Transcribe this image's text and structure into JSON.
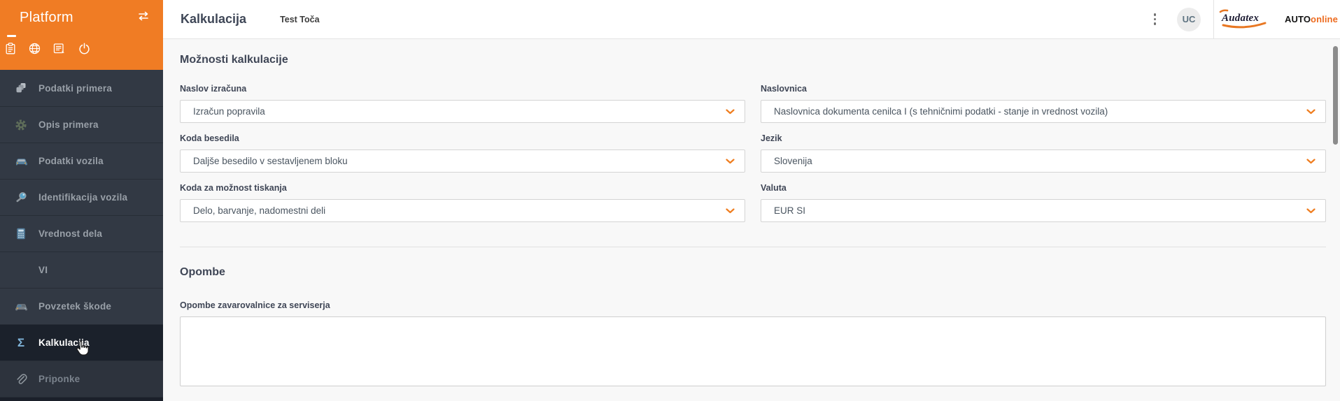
{
  "app": {
    "title": "Platform"
  },
  "sidebar": {
    "items": [
      {
        "label": "Podatki primera",
        "icon": "cubes-icon"
      },
      {
        "label": "Opis primera",
        "icon": "gear-icon"
      },
      {
        "label": "Podatki vozila",
        "icon": "car-icon"
      },
      {
        "label": "Identifikacija vozila",
        "icon": "magnifier-icon"
      },
      {
        "label": "Vrednost dela",
        "icon": "calculator-icon"
      },
      {
        "label": "VI",
        "icon": "none"
      },
      {
        "label": "Povzetek škode",
        "icon": "damaged-car-icon"
      },
      {
        "label": "Kalkulacija",
        "icon": "sigma-icon",
        "active": true
      },
      {
        "label": "Priponke",
        "icon": "paperclip-icon",
        "dimmed": true
      }
    ],
    "header_icons": [
      "clipboard-icon",
      "globe-icon",
      "form-icon",
      "power-icon",
      "swap-arrows-icon"
    ]
  },
  "header": {
    "title": "Kalkulacija",
    "subtitle": "Test Toča",
    "avatar_initials": "UC",
    "brand_audatex": "Audatex",
    "brand_auto": "AUTO",
    "brand_online": "online"
  },
  "main": {
    "section1_title": "Možnosti kalkulacije",
    "fields": [
      {
        "label": "Naslov izračuna",
        "value": "Izračun popravila"
      },
      {
        "label": "Naslovnica",
        "value": "Naslovnica dokumenta cenilca I (s tehničnimi podatki - stanje in vrednost vozila)"
      },
      {
        "label": "Koda besedila",
        "value": "Daljše besedilo v sestavljenem bloku"
      },
      {
        "label": "Jezik",
        "value": "Slovenija"
      },
      {
        "label": "Koda za možnost tiskanja",
        "value": "Delo, barvanje, nadomestni deli"
      },
      {
        "label": "Valuta",
        "value": "EUR SI"
      }
    ],
    "section2_title": "Opombe",
    "notes_label": "Opombe zavarovalnice za serviserja",
    "notes_value": ""
  },
  "colors": {
    "accent_orange": "#f07c24",
    "brand_orange": "#ed6b1f",
    "sidebar_bg": "#323944",
    "sidebar_active_bg": "#1b212b",
    "content_bg": "#f8f8f8",
    "chevron_orange": "#ef7d1f"
  }
}
